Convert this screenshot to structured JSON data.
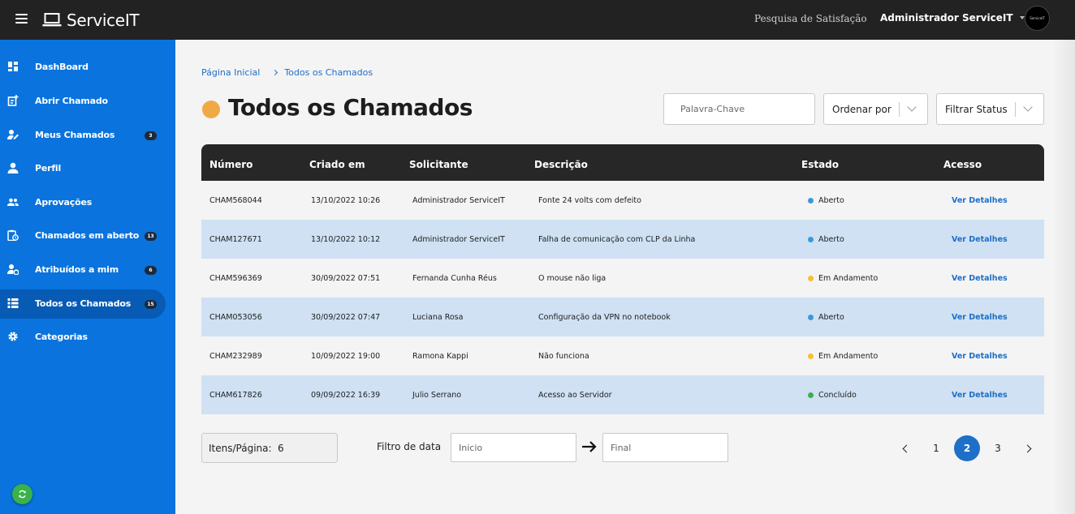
{
  "app": {
    "name": "ServiceIT",
    "survey_link": "Pesquisa de Satisfação",
    "user_name": "Administrador ServiceIT",
    "avatar_text": "ServiceIT"
  },
  "colors": {
    "sidebar": "#0a73dd",
    "topbar": "#222222",
    "accent": "#1e6fc8",
    "row_alt": "#cfe1f3",
    "status_open": "#3a9ad9",
    "status_progress": "#f2c230",
    "status_done": "#3ab24a"
  },
  "sidebar": {
    "items": [
      {
        "label": "DashBoard",
        "icon": "dashboard-icon",
        "badge": ""
      },
      {
        "label": "Abrir Chamado",
        "icon": "new-ticket-icon",
        "badge": ""
      },
      {
        "label": "Meus Chamados",
        "icon": "user-edit-icon",
        "badge": "3"
      },
      {
        "label": "Perfil",
        "icon": "person-icon",
        "badge": ""
      },
      {
        "label": "Aprovações",
        "icon": "people-icon",
        "badge": ""
      },
      {
        "label": "Chamados em aberto",
        "icon": "clipboard-clock-icon",
        "badge": "13"
      },
      {
        "label": "Atribuídos a mim",
        "icon": "user-gear-icon",
        "badge": "6"
      },
      {
        "label": "Todos os Chamados",
        "icon": "list-icon",
        "badge": "15"
      },
      {
        "label": "Categorias",
        "icon": "gear-icon",
        "badge": ""
      }
    ]
  },
  "breadcrumb": {
    "home": "Página Inicial",
    "current": "Todos os Chamados"
  },
  "page_title": "Todos os Chamados",
  "filters": {
    "search_placeholder": "Palavra-Chave",
    "order_label": "Ordenar por",
    "status_label": "Filtrar Status"
  },
  "table": {
    "headers": [
      "Número",
      "Criado em",
      "Solicitante",
      "Descrição",
      "Estado",
      "Acesso"
    ],
    "link_label": "Ver Detalhes",
    "rows": [
      {
        "numero": "CHAM568044",
        "criado": "13/10/2022 10:26",
        "solicitante": "Administrador ServiceIT",
        "descricao": "Fonte 24 volts com defeito",
        "estado": "Aberto",
        "estado_color": "#3a9ad9"
      },
      {
        "numero": "CHAM127671",
        "criado": "13/10/2022 10:12",
        "solicitante": "Administrador ServiceIT",
        "descricao": "Falha de comunicação com CLP da Linha",
        "estado": "Aberto",
        "estado_color": "#3a9ad9"
      },
      {
        "numero": "CHAM596369",
        "criado": "30/09/2022 07:51",
        "solicitante": "Fernanda Cunha Réus",
        "descricao": "O mouse não liga",
        "estado": "Em Andamento",
        "estado_color": "#f2c230"
      },
      {
        "numero": "CHAM053056",
        "criado": "30/09/2022 07:47",
        "solicitante": "Luciana Rosa",
        "descricao": "Configuração da VPN no notebook",
        "estado": "Aberto",
        "estado_color": "#3a9ad9"
      },
      {
        "numero": "CHAM232989",
        "criado": "10/09/2022 19:00",
        "solicitante": "Ramona Kappi",
        "descricao": "Não funciona",
        "estado": "Em Andamento",
        "estado_color": "#f2c230"
      },
      {
        "numero": "CHAM617826",
        "criado": "09/09/2022 16:39",
        "solicitante": "Julio Serrano",
        "descricao": "Acesso ao Servidor",
        "estado": "Concluído",
        "estado_color": "#3ab24a"
      }
    ]
  },
  "footer": {
    "per_page_label": "Itens/Página:",
    "per_page_value": "6",
    "date_filter_label": "Filtro de data",
    "date_start_placeholder": "Inicio",
    "date_end_placeholder": "Final",
    "pages": [
      "1",
      "2",
      "3"
    ],
    "current_page": "2"
  }
}
